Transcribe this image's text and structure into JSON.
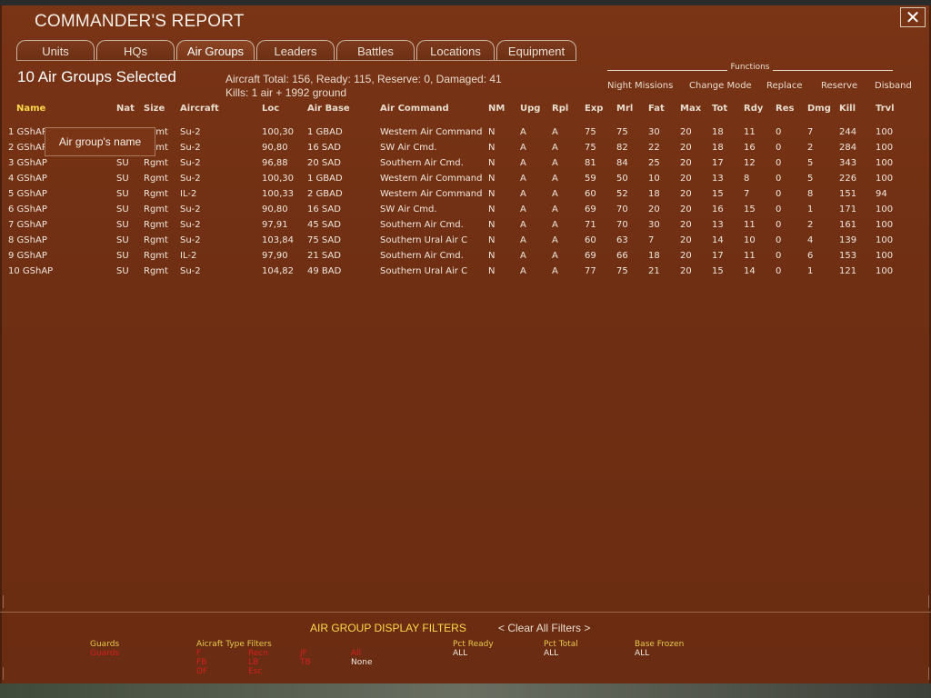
{
  "window": {
    "title": "COMMANDER'S REPORT",
    "close_label": "✕"
  },
  "tabs": [
    {
      "label": "Units",
      "active": false
    },
    {
      "label": "HQs",
      "active": false
    },
    {
      "label": "Air Groups",
      "active": true
    },
    {
      "label": "Leaders",
      "active": false
    },
    {
      "label": "Battles",
      "active": false
    },
    {
      "label": "Locations",
      "active": false
    },
    {
      "label": "Equipment",
      "active": false
    }
  ],
  "summary": {
    "selected": "10 Air Groups Selected",
    "aircraft_totals": "Aircraft Total: 156, Ready: 115, Reserve: 0, Damaged: 41",
    "kills": "Kills: 1 air + 1992 ground"
  },
  "functions": {
    "title": "Functions",
    "items": [
      "Night Missions",
      "Change Mode",
      "Replace",
      "Reserve",
      "Disband"
    ]
  },
  "table": {
    "columns": [
      "Name",
      "Nat",
      "Size",
      "Aircraft",
      "Loc",
      "Air Base",
      "Air Command",
      "NM",
      "Upg",
      "Rpl",
      "Exp",
      "Mrl",
      "Fat",
      "Max",
      "Tot",
      "Rdy",
      "Res",
      "Dmg",
      "Kill",
      "Trvl"
    ],
    "rows": [
      [
        "1 GShAP",
        "SU",
        "Rgmt",
        "Su-2",
        "100,30",
        "1 GBAD",
        "Western Air Command",
        "N",
        "A",
        "A",
        "75",
        "75",
        "30",
        "20",
        "18",
        "11",
        "0",
        "7",
        "244",
        "100"
      ],
      [
        "2 GShAP",
        "SU",
        "Rgmt",
        "Su-2",
        "90,80",
        "16 SAD",
        "SW Air Cmd.",
        "N",
        "A",
        "A",
        "75",
        "82",
        "22",
        "20",
        "18",
        "16",
        "0",
        "2",
        "284",
        "100"
      ],
      [
        "3 GShAP",
        "SU",
        "Rgmt",
        "Su-2",
        "96,88",
        "20 SAD",
        "Southern Air Cmd.",
        "N",
        "A",
        "A",
        "81",
        "84",
        "25",
        "20",
        "17",
        "12",
        "0",
        "5",
        "343",
        "100"
      ],
      [
        "4 GShAP",
        "SU",
        "Rgmt",
        "Su-2",
        "100,30",
        "1 GBAD",
        "Western Air Command",
        "N",
        "A",
        "A",
        "59",
        "50",
        "10",
        "20",
        "13",
        "8",
        "0",
        "5",
        "226",
        "100"
      ],
      [
        "5 GShAP",
        "SU",
        "Rgmt",
        "IL-2",
        "100,33",
        "2 GBAD",
        "Western Air Command",
        "N",
        "A",
        "A",
        "60",
        "52",
        "18",
        "20",
        "15",
        "7",
        "0",
        "8",
        "151",
        "94"
      ],
      [
        "6 GShAP",
        "SU",
        "Rgmt",
        "Su-2",
        "90,80",
        "16 SAD",
        "SW Air Cmd.",
        "N",
        "A",
        "A",
        "69",
        "70",
        "20",
        "20",
        "16",
        "15",
        "0",
        "1",
        "171",
        "100"
      ],
      [
        "7 GShAP",
        "SU",
        "Rgmt",
        "Su-2",
        "97,91",
        "45 SAD",
        "Southern Air Cmd.",
        "N",
        "A",
        "A",
        "71",
        "70",
        "30",
        "20",
        "13",
        "11",
        "0",
        "2",
        "161",
        "100"
      ],
      [
        "8 GShAP",
        "SU",
        "Rgmt",
        "Su-2",
        "103,84",
        "75 SAD",
        "Southern Ural Air C",
        "N",
        "A",
        "A",
        "60",
        "63",
        "7",
        "20",
        "14",
        "10",
        "0",
        "4",
        "139",
        "100"
      ],
      [
        "9 GShAP",
        "SU",
        "Rgmt",
        "IL-2",
        "97,90",
        "21 SAD",
        "Southern Air Cmd.",
        "N",
        "A",
        "A",
        "69",
        "66",
        "18",
        "20",
        "17",
        "11",
        "0",
        "6",
        "153",
        "100"
      ],
      [
        "10 GShAP",
        "SU",
        "Rgmt",
        "Su-2",
        "104,82",
        "49 BAD",
        "Southern Ural Air C",
        "N",
        "A",
        "A",
        "77",
        "75",
        "21",
        "20",
        "15",
        "14",
        "0",
        "1",
        "121",
        "100"
      ]
    ]
  },
  "tooltip": "Air group's name",
  "filters": {
    "title": "AIR GROUP DISPLAY FILTERS",
    "clear": "< Clear All Filters >",
    "guards_label": "Guards",
    "guards_value": "Guards",
    "aircraft_type_label": "Aicraft   Type   Filters",
    "aircraft_types_col1": [
      "F",
      "FB",
      "DF"
    ],
    "aircraft_types_col2": [
      "Recn",
      "LB",
      "Esc"
    ],
    "aircraft_types_col3": [
      "JF",
      "TB"
    ],
    "all_label": "All",
    "none_label": "None",
    "pct_ready_label": "Pct Ready",
    "pct_ready_value": "ALL",
    "pct_total_label": "Pct Total",
    "pct_total_value": "ALL",
    "base_frozen_label": "Base Frozen",
    "base_frozen_value": "ALL"
  },
  "colors": {
    "background": "#6f2f13",
    "header_highlight": "#ffd94a",
    "filter_inactive": "#d32020"
  }
}
